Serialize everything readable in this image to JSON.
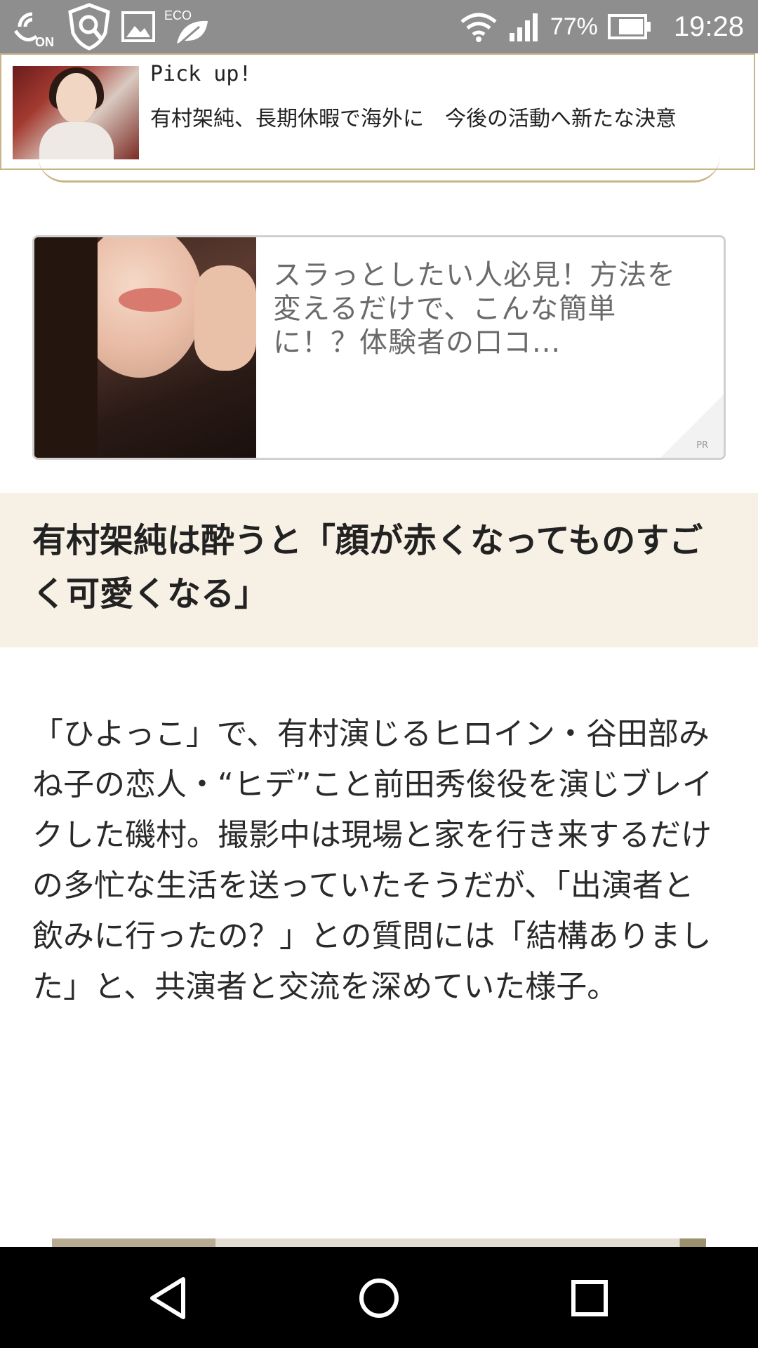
{
  "status_bar": {
    "battery_percent": "77%",
    "time": "19:28",
    "eco_label": "ECO",
    "on_label": "ON",
    "icons": [
      "nfc-on-icon",
      "shield-icon",
      "gallery-icon",
      "eco-leaf-icon",
      "wifi-icon",
      "signal-icon",
      "battery-icon"
    ]
  },
  "pickup": {
    "label": "Pick up!",
    "title": "有村架純、長期休暇で海外に　今後の活動へ新たな決意"
  },
  "ad": {
    "text": "スラっとしたい人必見！方法を変えるだけで、こんな簡単に！？体験者の口コ...",
    "pr_label": "PR"
  },
  "section": {
    "heading": "有村架純は酔うと「顔が赤くなってものすごく可愛くなる」"
  },
  "article": {
    "paragraph": "「ひよっこ」で、有村演じるヒロイン・谷田部みね子の恋人・“ヒデ”こと前田秀俊役を演じブレイクした磯村。撮影中は現場と家を行き来するだけの多忙な生活を送っていたそうだが、「出演者と飲みに行ったの？」との質問には「結構ありました」と、共演者と交流を深めていた様子。"
  },
  "nav": {
    "buttons": [
      "back-icon",
      "home-icon",
      "recents-icon"
    ]
  },
  "colors": {
    "status_bar_bg": "#8e8e8e",
    "pickup_border": "#c9b488",
    "section_bg": "#f7f0e4",
    "nav_bg": "#000000"
  }
}
